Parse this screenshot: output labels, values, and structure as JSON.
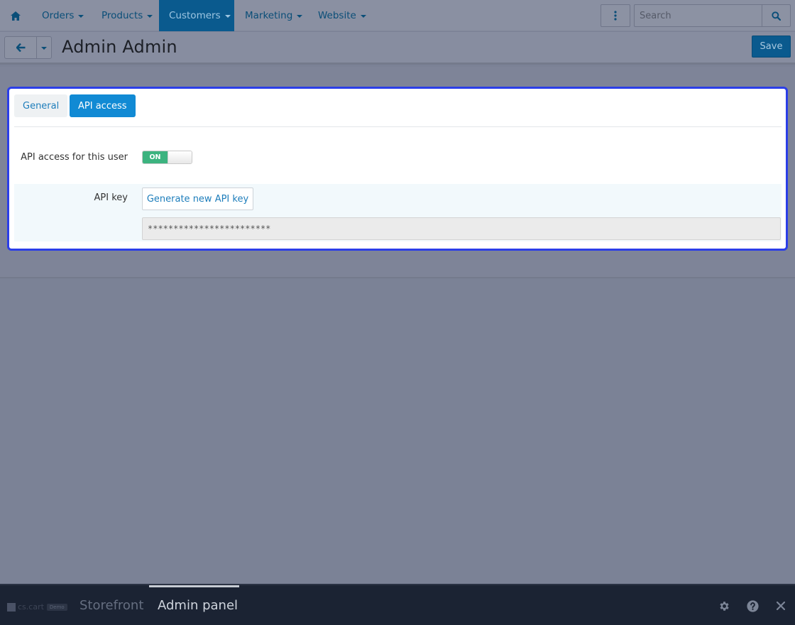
{
  "nav": {
    "items": [
      {
        "label": "Orders"
      },
      {
        "label": "Products"
      },
      {
        "label": "Customers"
      },
      {
        "label": "Marketing"
      },
      {
        "label": "Website"
      }
    ],
    "search_placeholder": "Search"
  },
  "header": {
    "title": "Admin Admin",
    "save_label": "Save"
  },
  "tabs": [
    {
      "label": "General",
      "active": false
    },
    {
      "label": "API access",
      "active": true
    }
  ],
  "api_access": {
    "toggle_label": "API access for this user",
    "toggle_state": "ON",
    "api_key_label": "API key",
    "generate_label": "Generate new API key",
    "api_key_value": "************************"
  },
  "bottom_bar": {
    "logo_text": "cs.cart",
    "logo_badge": "Demo",
    "links": [
      {
        "label": "Storefront",
        "active": false
      },
      {
        "label": "Admin panel",
        "active": true
      }
    ]
  },
  "colors": {
    "accent": "#118ad4",
    "highlight_border": "#2b3ee8",
    "toggle_on": "#3cb37f",
    "nav_active": "#0a5a8e"
  },
  "icons": [
    "home-icon",
    "kebab-icon",
    "search-icon",
    "arrow-left-icon",
    "caret-down-icon",
    "gear-icon",
    "help-icon",
    "close-icon"
  ]
}
